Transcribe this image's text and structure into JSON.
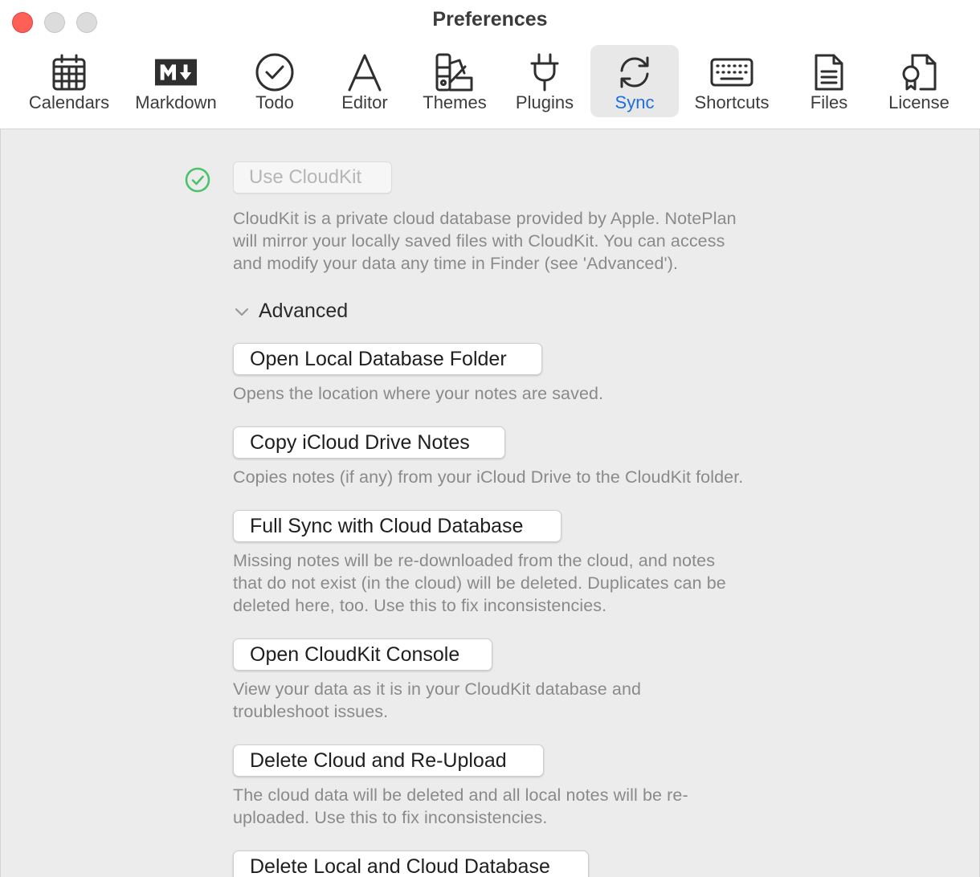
{
  "window": {
    "title": "Preferences"
  },
  "toolbar": {
    "active": "Sync",
    "tabs": [
      {
        "label": "Calendars",
        "icon": "calendar-icon"
      },
      {
        "label": "Markdown",
        "icon": "markdown-icon"
      },
      {
        "label": "Todo",
        "icon": "todo-check-icon"
      },
      {
        "label": "Editor",
        "icon": "editor-letter-icon"
      },
      {
        "label": "Themes",
        "icon": "themes-swatch-icon"
      },
      {
        "label": "Plugins",
        "icon": "plug-icon"
      },
      {
        "label": "Sync",
        "icon": "sync-icon"
      },
      {
        "label": "Shortcuts",
        "icon": "keyboard-icon"
      },
      {
        "label": "Files",
        "icon": "file-icon"
      },
      {
        "label": "License",
        "icon": "license-certificate-icon"
      }
    ]
  },
  "sync": {
    "use_cloudkit": {
      "label": "Use CloudKit",
      "checked": true,
      "status_icon": "check-circle-icon"
    },
    "cloudkit_description_lines": [
      "CloudKit is a private cloud database provided by Apple. NotePlan",
      "will mirror your locally saved files with CloudKit. You can access",
      "and modify your data any time in Finder (see 'Advanced')."
    ],
    "advanced": {
      "label": "Advanced",
      "expanded": true
    },
    "actions": [
      {
        "label": "Open Local Database Folder",
        "description_lines": [
          "Opens the location where your notes are saved."
        ]
      },
      {
        "label": "Copy iCloud Drive Notes",
        "description_lines": [
          "Copies notes (if any) from your iCloud Drive to the CloudKit folder."
        ]
      },
      {
        "label": "Full Sync with Cloud Database",
        "description_lines": [
          "Missing notes will be re-downloaded from the cloud, and notes",
          "that do not exist (in the cloud) will be deleted. Duplicates can be",
          "deleted here, too. Use this to fix inconsistencies."
        ]
      },
      {
        "label": "Open CloudKit Console",
        "description_lines": [
          "View your data as it is in your CloudKit database and",
          "troubleshoot issues."
        ]
      },
      {
        "label": "Delete Cloud and Re-Upload",
        "description_lines": [
          "The cloud data will be deleted and all local notes will be re-",
          "uploaded. Use this to fix inconsistencies."
        ]
      },
      {
        "label": "Delete Local and Cloud Database",
        "description_lines": []
      }
    ]
  },
  "colors": {
    "accent": "#1d6fe0",
    "check_green": "#4cc26b",
    "close_button": "#fe5f57"
  }
}
